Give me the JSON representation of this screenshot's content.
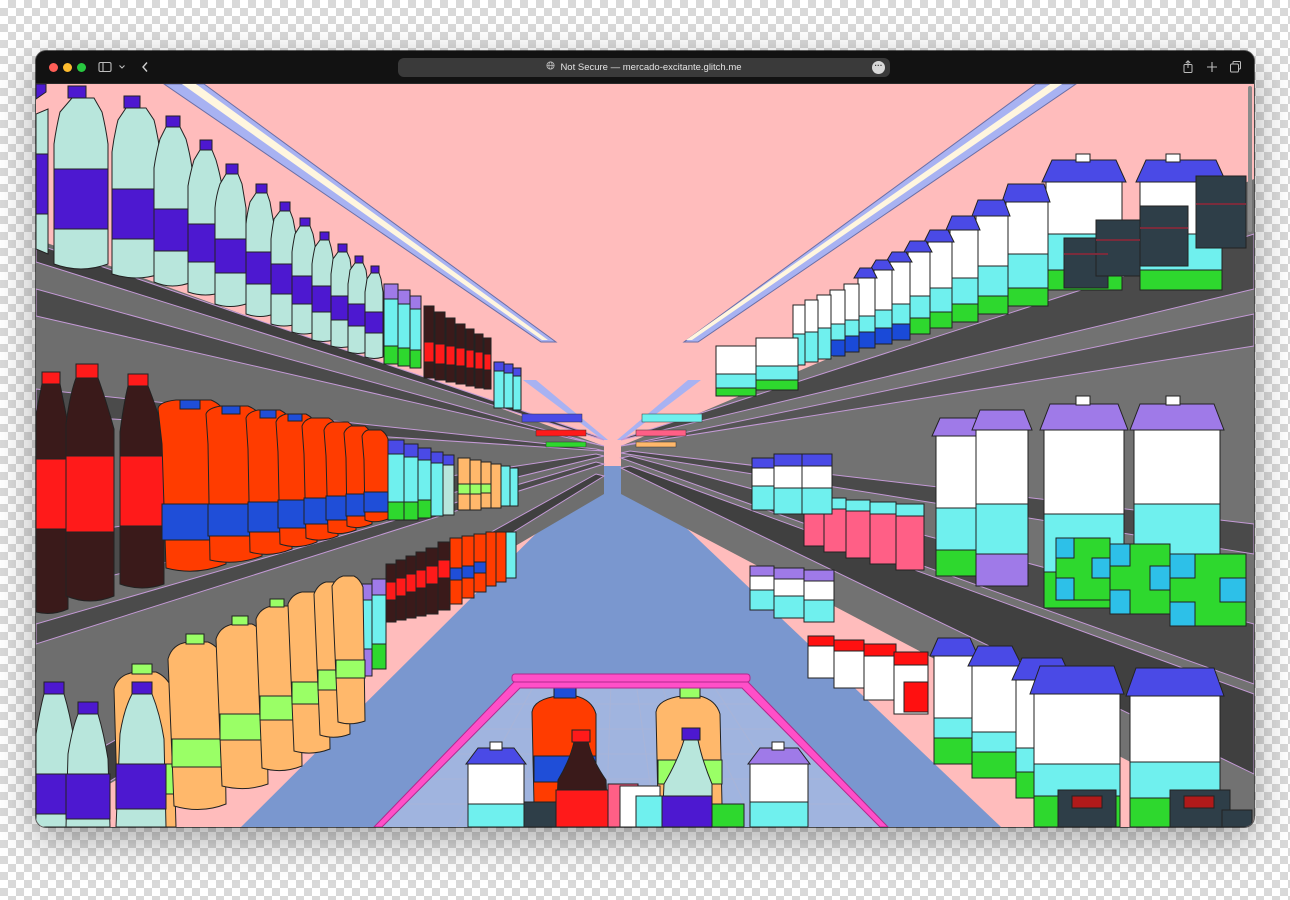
{
  "browser": {
    "url_security": "Not Secure",
    "url_separator": "—",
    "url_host": "mercado-excitante.glitch.me",
    "icons": {
      "sidebar": "sidebar-icon",
      "chevron": "chevron-down-icon",
      "back": "back-icon",
      "site": "globe-icon",
      "more": "ellipsis-icon",
      "share": "share-icon",
      "new_tab": "plus-icon",
      "tabs": "tab-overview-icon"
    }
  },
  "scene": {
    "description_kind": "illustrated supermarket aisle with shopping cart",
    "colors": {
      "ceiling": "#ffbcbc",
      "floor": "#7a97cf",
      "shelf_wall": "#6f6f6f",
      "shelf_board": "#4a4a4a",
      "light_outer": "#a8b2f2",
      "light_inner": "#fff6df",
      "cart_frame": "#ff4fc8",
      "bottle_body": "#b8e6dc",
      "bottle_label": "#4d18d0",
      "cola": "#3a1a1a",
      "cola_label": "#ff1a1a",
      "orange_jug": "#ff3c00",
      "orange_band": "#1f4ed8",
      "yellow_jug": "#ffb86b",
      "yellow_band": "#9aff66",
      "carton_top_blue": "#4a4ae6",
      "carton_top_purple": "#9f7ae8",
      "carton_mid": "#6ff0ee",
      "carton_base": "#2ed82e",
      "can_green": "#2ed82e",
      "can_cyan": "#2dc0e8",
      "can_blue": "#1a4ad8",
      "tub_pink": "#ff5f86",
      "tub_red": "#ff1010",
      "dark_can": "#2e3e48"
    }
  }
}
